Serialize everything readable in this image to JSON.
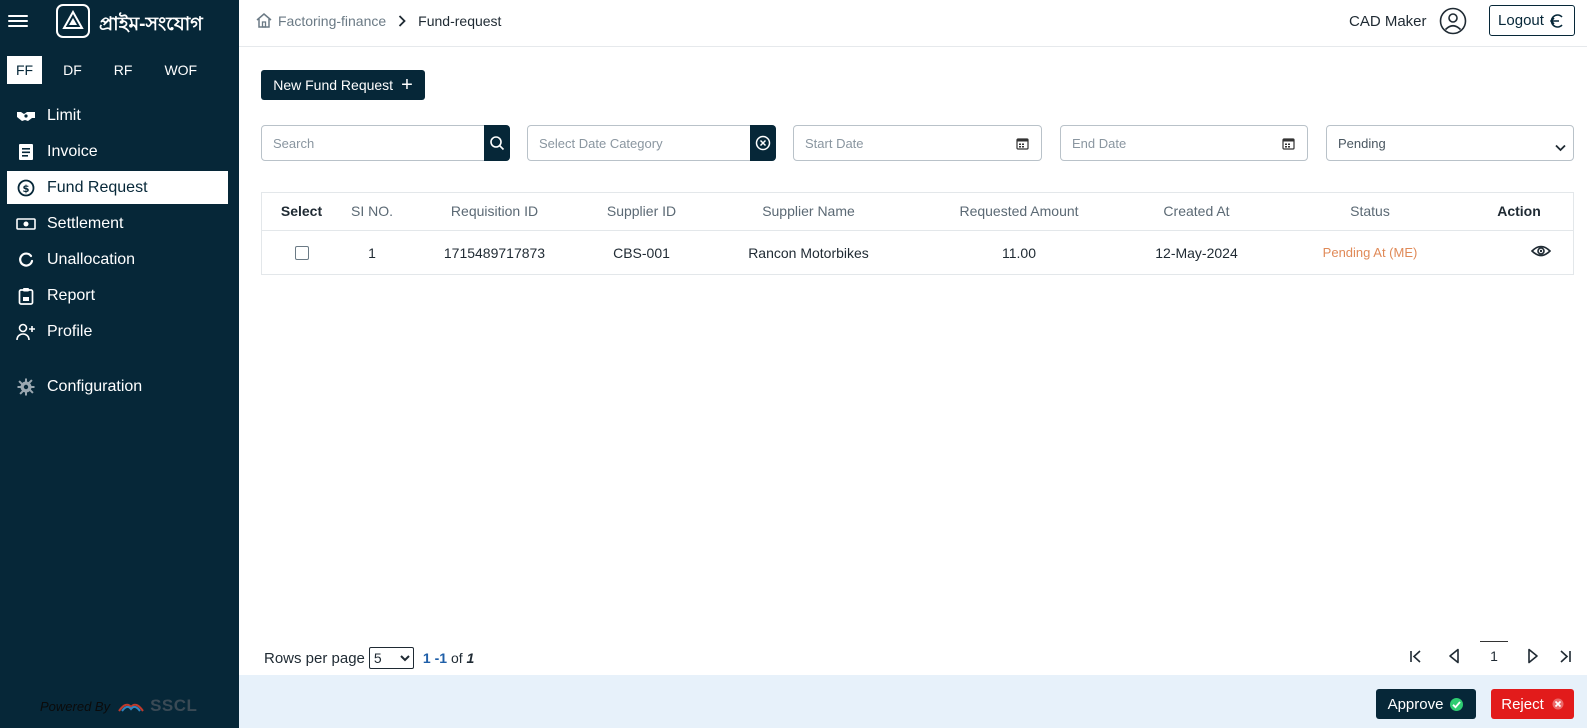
{
  "sidebar": {
    "logo_text": "প্রাইম-সংযোগ",
    "product_tabs": [
      "FF",
      "DF",
      "RF",
      "WOF"
    ],
    "active_product_tab": "FF",
    "items": [
      {
        "label": "Limit",
        "icon": "handshake-icon"
      },
      {
        "label": "Invoice",
        "icon": "document-icon"
      },
      {
        "label": "Fund Request",
        "icon": "money-circle-icon"
      },
      {
        "label": "Settlement",
        "icon": "cash-icon"
      },
      {
        "label": "Unallocation",
        "icon": "circle-icon"
      },
      {
        "label": "Report",
        "icon": "clipboard-icon"
      },
      {
        "label": "Profile",
        "icon": "user-plus-icon"
      },
      {
        "label": "Configuration",
        "icon": "gear-icon"
      }
    ],
    "active_item": "Fund Request",
    "powered_by": "Powered By",
    "powered_brand": "SSCL"
  },
  "header": {
    "breadcrumb_root": "Factoring-finance",
    "breadcrumb_current": "Fund-request",
    "user_name": "CAD Maker",
    "logout_label": "Logout"
  },
  "toolbar": {
    "new_request_label": "New Fund Request"
  },
  "filters": {
    "search_placeholder": "Search",
    "date_category_placeholder": "Select Date Category",
    "start_date_placeholder": "Start Date",
    "end_date_placeholder": "End Date",
    "status_value": "Pending"
  },
  "table": {
    "headers": [
      "Select",
      "SI NO.",
      "Requisition ID",
      "Supplier ID",
      "Supplier Name",
      "Requested Amount",
      "Created At",
      "Status",
      "Action"
    ],
    "rows": [
      {
        "sl": "1",
        "requisition_id": "1715489717873",
        "supplier_id": "CBS-001",
        "supplier_name": "Rancon Motorbikes",
        "amount": "11.00",
        "created_at": "12-May-2024",
        "status": "Pending At (ME)"
      }
    ]
  },
  "pagination": {
    "rows_per_page_label": "Rows per page",
    "rows_per_page_value": "5",
    "range_start": "1",
    "range_end": "-1",
    "of_label": "of",
    "total": "1",
    "current_page": "1"
  },
  "footer": {
    "approve_label": "Approve",
    "reject_label": "Reject"
  },
  "colors": {
    "sidebar_bg": "#062738",
    "primary": "#062738",
    "status_pending": "#e08a58",
    "reject": "#e21b1b",
    "footer_bg": "#e7f1fa"
  }
}
